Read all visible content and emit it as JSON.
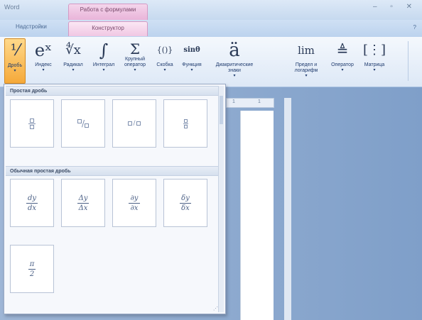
{
  "window": {
    "app_title": "Word",
    "context_title": "Работа с формулами",
    "controls": "– ▫ ✕"
  },
  "tabs": {
    "addins": "Надстройки",
    "design": "Конструктор",
    "help_glyph": "?"
  },
  "ribbon": {
    "fraction": {
      "label": "Дробь",
      "glyph": "⅟"
    },
    "script": {
      "label": "Индекс",
      "glyph": "eˣ"
    },
    "radical": {
      "label": "Радикал",
      "glyph": "∜x"
    },
    "integral": {
      "label": "Интеграл",
      "glyph": "∫"
    },
    "large_operator": {
      "label": "Крупный оператор",
      "glyph": "Σ"
    },
    "bracket": {
      "label": "Скобка",
      "glyph": "{()}"
    },
    "function": {
      "label": "Функция",
      "glyph": "sinθ"
    },
    "accent": {
      "label": "Диакритические знаки",
      "glyph": "ä"
    },
    "limit": {
      "label": "Предел и логарифм",
      "glyph": "lim"
    },
    "operator": {
      "label": "Оператор",
      "glyph": "≜"
    },
    "matrix": {
      "label": "Матрица",
      "glyph": "[⋮]"
    }
  },
  "gallery": {
    "section1_title": "Простая дробь",
    "section2_title": "Обычная простая дробь",
    "common": [
      {
        "num": "dy",
        "den": "dx"
      },
      {
        "num": "Δy",
        "den": "Δx"
      },
      {
        "num": "∂y",
        "den": "∂x"
      },
      {
        "num": "δy",
        "den": "δx"
      },
      {
        "num": "π",
        "den": "2"
      }
    ]
  },
  "ruler": {
    "mark1": "1",
    "mark2": "1"
  }
}
